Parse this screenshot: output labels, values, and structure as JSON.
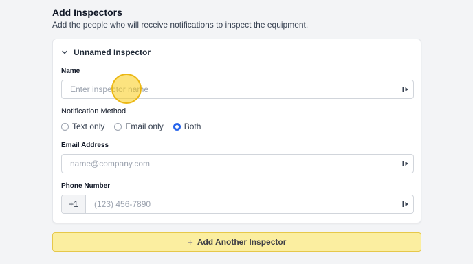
{
  "section": {
    "title": "Add Inspectors",
    "subtitle": "Add the people who will receive notifications to inspect the equipment."
  },
  "inspector": {
    "title": "Unnamed Inspector",
    "name_label": "Name",
    "name_placeholder": "Enter inspector name",
    "method_label": "Notification Method",
    "methods": [
      {
        "label": "Text only",
        "selected": false
      },
      {
        "label": "Email only",
        "selected": false
      },
      {
        "label": "Both",
        "selected": true
      }
    ],
    "email_label": "Email Address",
    "email_placeholder": "name@company.com",
    "phone_label": "Phone Number",
    "phone_prefix": "+1",
    "phone_placeholder": "(123) 456-7890"
  },
  "add_button": {
    "icon": "plus-icon",
    "label": "Add Another Inspector"
  },
  "colors": {
    "accent": "#2563eb",
    "button_bg": "#fbeea0",
    "cursor_highlight": "#facc15"
  }
}
